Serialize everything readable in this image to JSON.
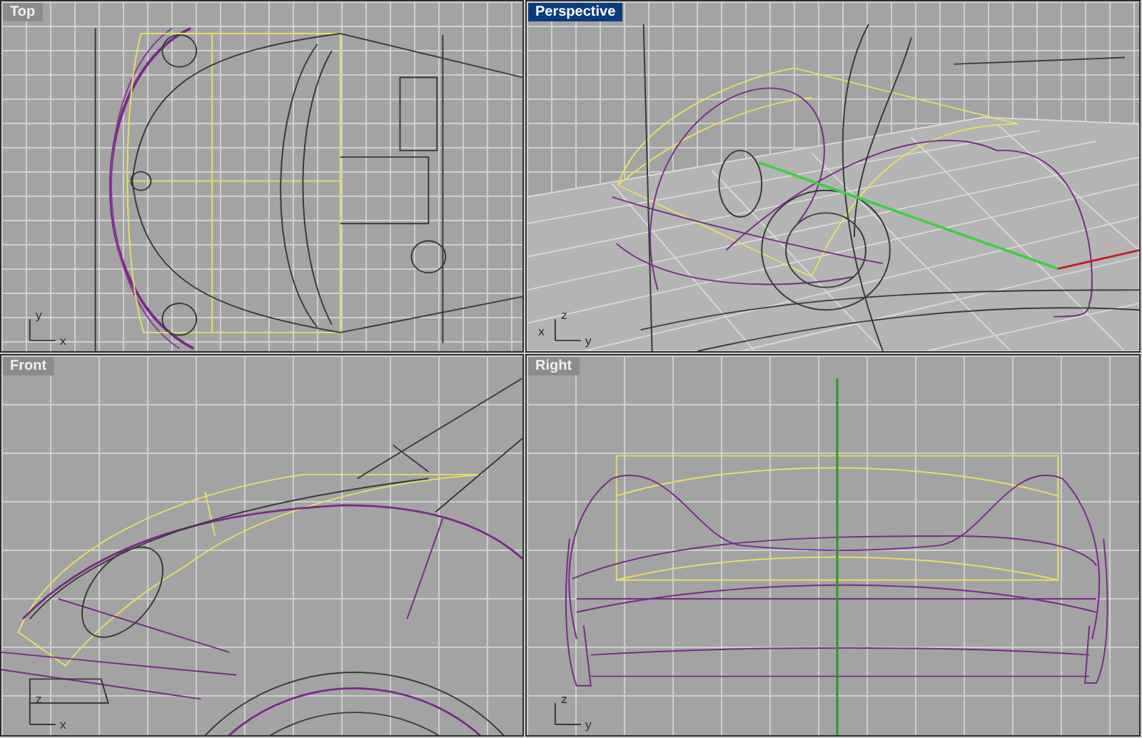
{
  "viewports": [
    {
      "title": "Top",
      "selected": false,
      "kind": "top",
      "axes": [
        "y",
        "x"
      ]
    },
    {
      "title": "Perspective",
      "selected": true,
      "kind": "perspective",
      "axes": [
        "z",
        "x",
        "y"
      ]
    },
    {
      "title": "Front",
      "selected": false,
      "kind": "front",
      "axes": [
        "z",
        "x"
      ]
    },
    {
      "title": "Right",
      "selected": false,
      "kind": "right",
      "axes": [
        "z",
        "y"
      ]
    }
  ]
}
